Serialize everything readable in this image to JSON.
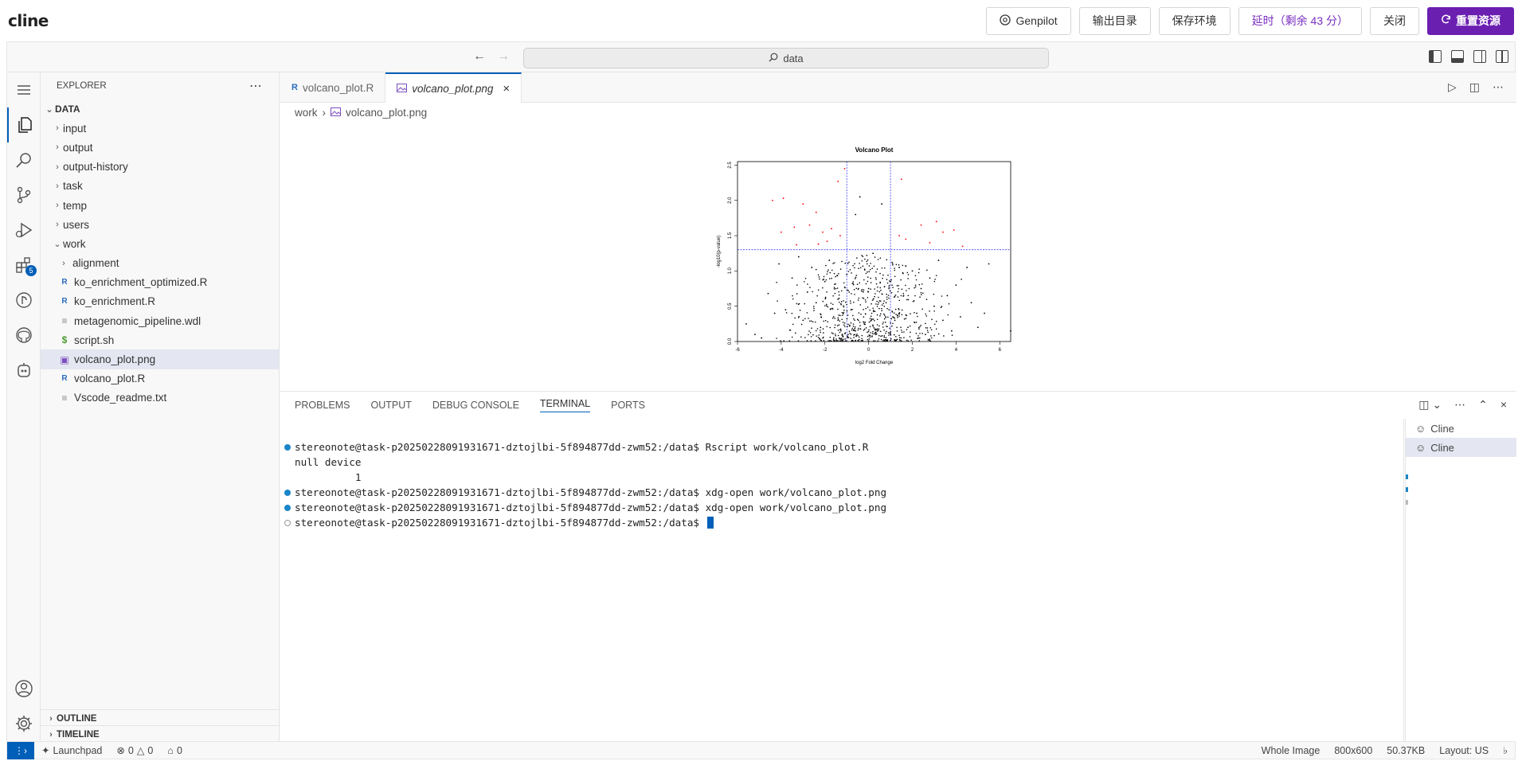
{
  "app": {
    "brand": "cline",
    "buttons": {
      "genpilot": "Genpilot",
      "output_dir": "输出目录",
      "save_env": "保存环境",
      "extend": "延时（剩余 43 分）",
      "close": "关闭",
      "reset": "重置资源"
    }
  },
  "titlebar": {
    "search_text": "data"
  },
  "sidebar": {
    "title": "EXPLORER",
    "root": "DATA",
    "folders": [
      "input",
      "output",
      "output-history",
      "task",
      "temp",
      "users"
    ],
    "work_folder": "work",
    "work_items": [
      {
        "label": "alignment",
        "type": "folder"
      },
      {
        "label": "ko_enrichment_optimized.R",
        "type": "r"
      },
      {
        "label": "ko_enrichment.R",
        "type": "r"
      },
      {
        "label": "metagenomic_pipeline.wdl",
        "type": "text"
      },
      {
        "label": "script.sh",
        "type": "shell"
      },
      {
        "label": "volcano_plot.png",
        "type": "image"
      },
      {
        "label": "volcano_plot.R",
        "type": "r"
      },
      {
        "label": "Vscode_readme.txt",
        "type": "text"
      }
    ],
    "outline": "OUTLINE",
    "timeline": "TIMELINE"
  },
  "activity_badge": "5",
  "editor": {
    "tabs": [
      {
        "label": "volcano_plot.R",
        "active": false
      },
      {
        "label": "volcano_plot.png",
        "active": true
      }
    ],
    "breadcrumb": [
      "work",
      "volcano_plot.png"
    ]
  },
  "chart_data": {
    "type": "scatter",
    "title": "Volcano Plot",
    "xlabel": "log2 Fold Change",
    "ylabel": "-log10(p-value)",
    "xlim": [
      -6,
      6.5
    ],
    "ylim": [
      0,
      2.55
    ],
    "xticks": [
      "-6",
      "-4",
      "-2",
      "0",
      "2",
      "4",
      "6"
    ],
    "yticks": [
      "0.0",
      "0.5",
      "1.0",
      "1.5",
      "2.0",
      "2.5"
    ],
    "thresholds": {
      "x": [
        -1,
        1
      ],
      "y": 1.3
    },
    "colors": {
      "significant": "#ff0000",
      "other": "#000000",
      "threshold": "#2020ff"
    },
    "series": [
      {
        "name": "significant",
        "points": [
          [
            -4.4,
            2.0
          ],
          [
            -3.9,
            2.03
          ],
          [
            -3.0,
            1.95
          ],
          [
            -2.4,
            1.83
          ],
          [
            -1.4,
            2.27
          ],
          [
            -1.1,
            2.45
          ],
          [
            1.5,
            2.3
          ],
          [
            -3.4,
            1.62
          ],
          [
            -2.7,
            1.65
          ],
          [
            -2.1,
            1.55
          ],
          [
            -1.7,
            1.6
          ],
          [
            -1.3,
            1.5
          ],
          [
            2.4,
            1.65
          ],
          [
            3.1,
            1.7
          ],
          [
            3.9,
            1.58
          ],
          [
            1.4,
            1.5
          ],
          [
            4.3,
            1.35
          ],
          [
            -3.3,
            1.37
          ],
          [
            -2.3,
            1.38
          ],
          [
            2.8,
            1.4
          ],
          [
            1.7,
            1.45
          ],
          [
            -4.0,
            1.55
          ],
          [
            3.4,
            1.55
          ],
          [
            -1.9,
            1.42
          ]
        ]
      },
      {
        "name": "non-significant",
        "points": [
          [
            -5.6,
            0.25
          ],
          [
            -5.2,
            0.1
          ],
          [
            -4.9,
            0.05
          ],
          [
            -4.6,
            0.68
          ],
          [
            -4.3,
            0.4
          ],
          [
            -4.1,
            1.1
          ],
          [
            -3.8,
            0.45
          ],
          [
            -3.5,
            0.9
          ],
          [
            -3.2,
            1.2
          ],
          [
            -3.0,
            0.3
          ],
          [
            -2.8,
            0.7
          ],
          [
            -2.6,
            1.05
          ],
          [
            -2.4,
            0.55
          ],
          [
            -2.2,
            0.2
          ],
          [
            -2.0,
            0.85
          ],
          [
            -1.8,
            1.15
          ],
          [
            -1.6,
            0.35
          ],
          [
            -1.4,
            0.6
          ],
          [
            -1.2,
            0.1
          ],
          [
            -1.0,
            0.95
          ],
          [
            -0.8,
            0.45
          ],
          [
            -0.6,
            1.8
          ],
          [
            -0.4,
            2.05
          ],
          [
            -0.2,
            0.25
          ],
          [
            0.0,
            0.75
          ],
          [
            0.2,
            1.25
          ],
          [
            0.4,
            0.15
          ],
          [
            0.6,
            1.95
          ],
          [
            0.8,
            0.55
          ],
          [
            1.0,
            0.85
          ],
          [
            1.2,
            0.3
          ],
          [
            1.4,
            1.05
          ],
          [
            1.6,
            0.65
          ],
          [
            1.8,
            0.2
          ],
          [
            2.0,
            1.0
          ],
          [
            2.2,
            0.4
          ],
          [
            2.4,
            0.75
          ],
          [
            2.6,
            0.1
          ],
          [
            2.8,
            0.9
          ],
          [
            3.0,
            0.5
          ],
          [
            3.2,
            1.15
          ],
          [
            3.4,
            0.3
          ],
          [
            3.6,
            0.65
          ],
          [
            3.8,
            0.15
          ],
          [
            4.0,
            0.8
          ],
          [
            4.2,
            0.35
          ],
          [
            4.5,
            1.05
          ],
          [
            4.7,
            0.55
          ],
          [
            5.0,
            0.2
          ],
          [
            5.3,
            0.4
          ],
          [
            5.5,
            1.1
          ],
          [
            6.5,
            0.15
          ]
        ]
      }
    ]
  },
  "panel": {
    "tabs": [
      "PROBLEMS",
      "OUTPUT",
      "DEBUG CONSOLE",
      "TERMINAL",
      "PORTS"
    ],
    "active_tab": "TERMINAL",
    "terminal_lines": [
      {
        "dot": "filled",
        "text": "stereonote@task-p20250228091931671-dztojlbi-5f894877dd-zwm52:/data$ Rscript work/volcano_plot.R"
      },
      {
        "dot": "none",
        "text": "null device"
      },
      {
        "dot": "none",
        "text": "          1"
      },
      {
        "dot": "filled",
        "text": "stereonote@task-p20250228091931671-dztojlbi-5f894877dd-zwm52:/data$ xdg-open work/volcano_plot.png"
      },
      {
        "dot": "filled",
        "text": "stereonote@task-p20250228091931671-dztojlbi-5f894877dd-zwm52:/data$ xdg-open work/volcano_plot.png"
      },
      {
        "dot": "hollow",
        "text": "stereonote@task-p20250228091931671-dztojlbi-5f894877dd-zwm52:/data$ "
      }
    ],
    "terminal_instances": [
      "Cline",
      "Cline"
    ]
  },
  "statusbar": {
    "launchpad": "Launchpad",
    "errors": "0",
    "warnings": "0",
    "ports": "0",
    "view_mode": "Whole Image",
    "dimensions": "800x600",
    "size": "50.37KB",
    "layout": "Layout: US"
  }
}
